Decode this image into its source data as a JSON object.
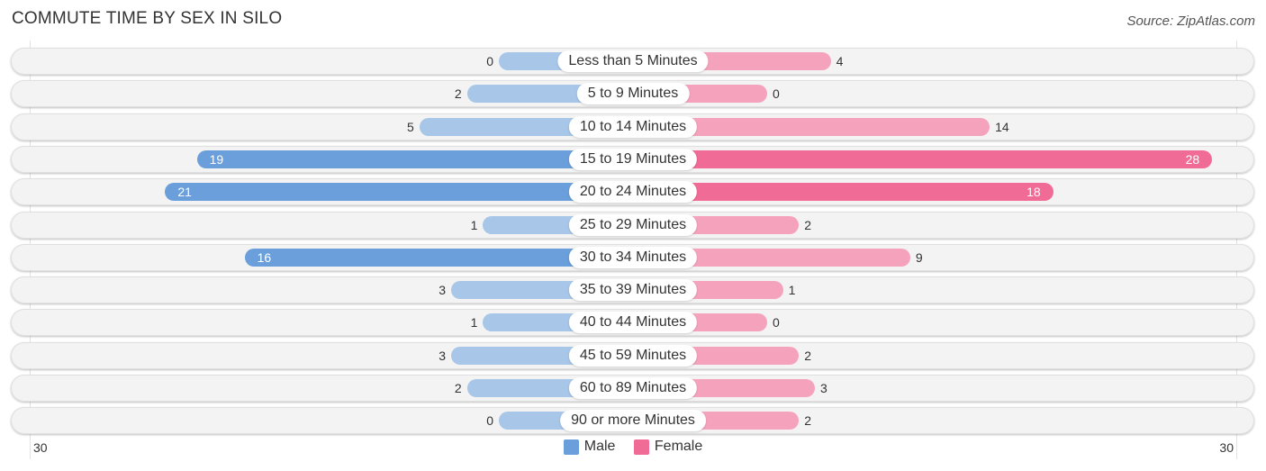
{
  "header": {
    "title": "COMMUTE TIME BY SEX IN SILO",
    "source": "Source: ZipAtlas.com"
  },
  "colors": {
    "male": "#a7c6e8",
    "male_strong": "#6a9fdb",
    "female": "#f5a3bc",
    "female_strong": "#f06b95",
    "row_bg": "#f3f3f3"
  },
  "chart_data": {
    "type": "bar",
    "orientation": "horizontal-diverging",
    "title": "COMMUTE TIME BY SEX IN SILO",
    "categories": [
      "Less than 5 Minutes",
      "5 to 9 Minutes",
      "10 to 14 Minutes",
      "15 to 19 Minutes",
      "20 to 24 Minutes",
      "25 to 29 Minutes",
      "30 to 34 Minutes",
      "35 to 39 Minutes",
      "40 to 44 Minutes",
      "45 to 59 Minutes",
      "60 to 89 Minutes",
      "90 or more Minutes"
    ],
    "series": [
      {
        "name": "Male",
        "values": [
          0,
          2,
          5,
          19,
          21,
          1,
          16,
          3,
          1,
          3,
          2,
          0
        ]
      },
      {
        "name": "Female",
        "values": [
          4,
          0,
          14,
          28,
          18,
          2,
          9,
          1,
          0,
          2,
          3,
          2
        ]
      }
    ],
    "xlim": [
      -30,
      30
    ],
    "axis_labels": {
      "left": "30",
      "right": "30"
    },
    "legend": {
      "position": "bottom-center",
      "entries": [
        "Male",
        "Female"
      ]
    },
    "grid": false
  },
  "legend": {
    "male": "Male",
    "female": "Female"
  },
  "axis": {
    "left": "30",
    "right": "30"
  }
}
